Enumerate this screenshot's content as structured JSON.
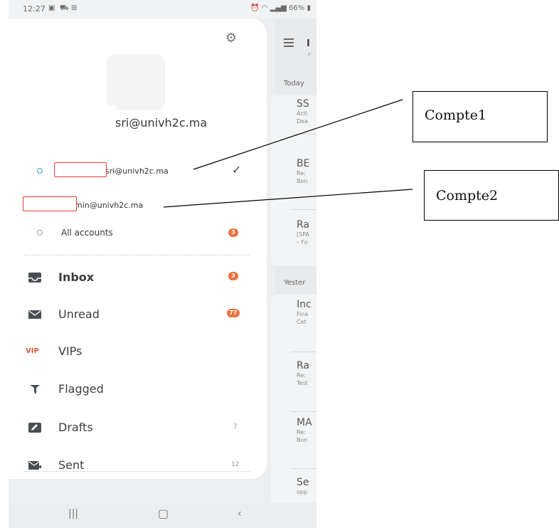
{
  "status": {
    "time": "12:27",
    "battery": "66%"
  },
  "background": {
    "title": "I",
    "subtitle": "r",
    "sections": [
      "Today",
      "Yester"
    ],
    "items": [
      {
        "subject": "SS",
        "lines": [
          "Acti",
          "Dea"
        ]
      },
      {
        "subject": "BE",
        "lines": [
          "Re:",
          "Bon"
        ]
      },
      {
        "subject": "Ra",
        "lines": [
          "[SPA",
          "– Fo"
        ]
      },
      {
        "subject": "Inc",
        "lines": [
          "Fina",
          "Cet"
        ]
      },
      {
        "subject": "Ra",
        "lines": [
          "Re:",
          "Test"
        ]
      },
      {
        "subject": "MA",
        "lines": [
          "Re:",
          "Bon"
        ]
      },
      {
        "subject": "Se",
        "lines": [
          "opp"
        ]
      }
    ]
  },
  "drawer": {
    "account_title": "sri@univh2c.ma",
    "accounts": [
      {
        "label": "sri@univh2c.ma",
        "selected": true
      },
      {
        "label": "min@univh2c.ma",
        "selected": false
      }
    ],
    "all_accounts": {
      "label": "All accounts",
      "badge": "3"
    },
    "folders": [
      {
        "icon": "inbox-icon",
        "label": "Inbox",
        "badge": "3",
        "count": ""
      },
      {
        "icon": "envelope-icon",
        "label": "Unread",
        "badge": "77",
        "count": ""
      },
      {
        "icon": "vip-icon",
        "icon_text": "VIP",
        "label": "VIPs",
        "badge": "",
        "count": ""
      },
      {
        "icon": "flag-icon",
        "label": "Flagged",
        "badge": "",
        "count": ""
      },
      {
        "icon": "pencil-icon",
        "label": "Drafts",
        "badge": "",
        "count": "7"
      },
      {
        "icon": "sent-icon",
        "label": "Sent",
        "badge": "",
        "count": "12"
      }
    ]
  },
  "callouts": [
    {
      "label": "Compte1"
    },
    {
      "label": "Compte2"
    }
  ],
  "colors": {
    "badge": "#e8733f",
    "redbox": "#e53935",
    "vip": "#e25a3a"
  }
}
